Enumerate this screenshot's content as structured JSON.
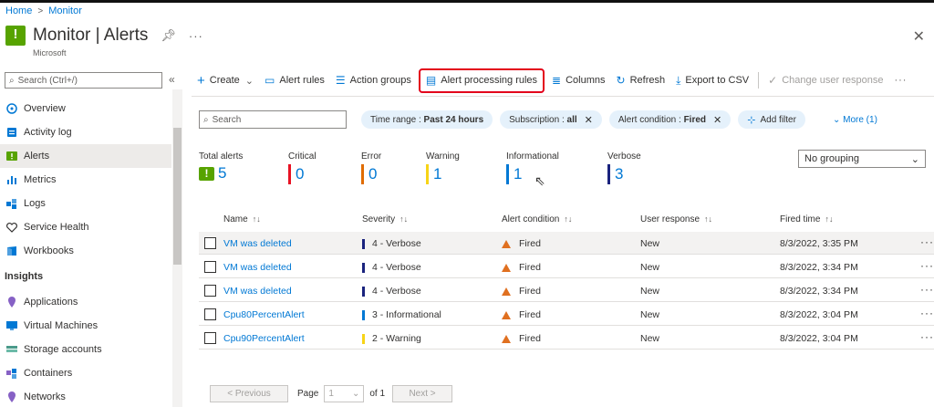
{
  "breadcrumb": {
    "home": "Home",
    "current": "Monitor"
  },
  "header": {
    "title": "Monitor | Alerts",
    "subtitle": "Microsoft"
  },
  "sidebar": {
    "search_placeholder": "Search (Ctrl+/)",
    "items": [
      {
        "label": "Overview",
        "icon": "overview-icon",
        "active": false
      },
      {
        "label": "Activity log",
        "icon": "activity-log-icon",
        "active": false
      },
      {
        "label": "Alerts",
        "icon": "alerts-icon",
        "active": true
      },
      {
        "label": "Metrics",
        "icon": "metrics-icon",
        "active": false
      },
      {
        "label": "Logs",
        "icon": "logs-icon",
        "active": false
      },
      {
        "label": "Service Health",
        "icon": "heart-icon",
        "active": false
      },
      {
        "label": "Workbooks",
        "icon": "workbooks-icon",
        "active": false
      }
    ],
    "section_insights": "Insights",
    "insights": [
      {
        "label": "Applications",
        "icon": "applications-icon"
      },
      {
        "label": "Virtual Machines",
        "icon": "vm-icon"
      },
      {
        "label": "Storage accounts",
        "icon": "storage-icon"
      },
      {
        "label": "Containers",
        "icon": "containers-icon"
      },
      {
        "label": "Networks",
        "icon": "networks-icon"
      }
    ]
  },
  "toolbar": {
    "create": "Create",
    "alert_rules": "Alert rules",
    "action_groups": "Action groups",
    "alert_processing_rules": "Alert processing rules",
    "columns": "Columns",
    "refresh": "Refresh",
    "export": "Export to CSV",
    "change_response": "Change user response"
  },
  "filters": {
    "search_placeholder": "Search",
    "time_range_label": "Time range : ",
    "time_range_value": "Past 24 hours",
    "subscription_label": "Subscription : ",
    "subscription_value": "all",
    "alert_condition_label": "Alert condition : ",
    "alert_condition_value": "Fired",
    "add_filter": "Add filter",
    "more": "More (1)"
  },
  "summary": {
    "total_label": "Total alerts",
    "total": "5",
    "critical_label": "Critical",
    "critical": "0",
    "error_label": "Error",
    "error": "0",
    "warning_label": "Warning",
    "warning": "1",
    "informational_label": "Informational",
    "informational": "1",
    "verbose_label": "Verbose",
    "verbose": "3"
  },
  "colors": {
    "critical": "#e81123",
    "error": "#e06c00",
    "warning": "#f7d417",
    "informational": "#0078d4",
    "verbose": "#1a237e"
  },
  "grouping": {
    "value": "No grouping"
  },
  "table": {
    "headers": {
      "name": "Name",
      "severity": "Severity",
      "condition": "Alert condition",
      "response": "User response",
      "fired": "Fired time"
    },
    "rows": [
      {
        "name": "VM was deleted",
        "severity": "4 - Verbose",
        "sev_color": "#1a237e",
        "condition": "Fired",
        "response": "New",
        "fired": "8/3/2022, 3:35 PM",
        "selected": true
      },
      {
        "name": "VM was deleted",
        "severity": "4 - Verbose",
        "sev_color": "#1a237e",
        "condition": "Fired",
        "response": "New",
        "fired": "8/3/2022, 3:34 PM",
        "selected": false
      },
      {
        "name": "VM was deleted",
        "severity": "4 - Verbose",
        "sev_color": "#1a237e",
        "condition": "Fired",
        "response": "New",
        "fired": "8/3/2022, 3:34 PM",
        "selected": false
      },
      {
        "name": "Cpu80PercentAlert",
        "severity": "3 - Informational",
        "sev_color": "#0078d4",
        "condition": "Fired",
        "response": "New",
        "fired": "8/3/2022, 3:04 PM",
        "selected": false
      },
      {
        "name": "Cpu90PercentAlert",
        "severity": "2 - Warning",
        "sev_color": "#f7d417",
        "condition": "Fired",
        "response": "New",
        "fired": "8/3/2022, 3:04 PM",
        "selected": false
      }
    ]
  },
  "pager": {
    "previous": "< Previous",
    "page_label": "Page",
    "page_value": "1",
    "of": "of 1",
    "next": "Next >"
  }
}
